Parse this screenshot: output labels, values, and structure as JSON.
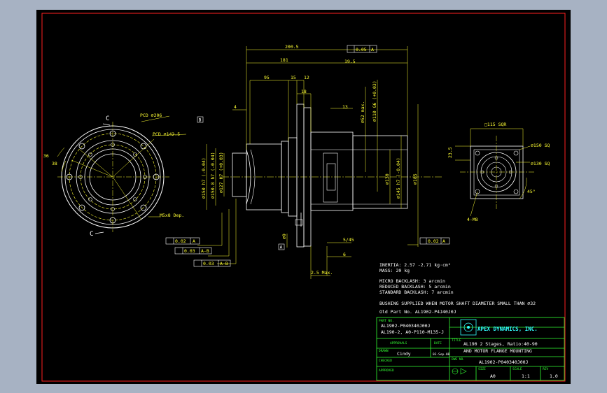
{
  "drawing": {
    "dimensions": {
      "overall_length": "200.5",
      "length_181": "181",
      "length_19_5": "19.5",
      "length_95": "95",
      "length_15": "15",
      "length_12": "12",
      "length_18": "18",
      "length_4": "4",
      "length_13": "13",
      "length_2_5": "2.5 Max.",
      "length_5_45": "5/45",
      "length_6": "6",
      "pcd_206": "PCD ⌀206",
      "pcd_142_5": "PCD ⌀142.5",
      "angle_36": "36",
      "angle_38": "38",
      "hole_spec": "M5x8 Dep.",
      "section_c": "C",
      "datum_b": "B",
      "datum_a": "A",
      "dia_150_h7": "⌀150 h7 (-0.04)",
      "dia_150": "⌀150.8 h7 (-0.04)",
      "dia_127": "⌀127 H7 (+0.03)",
      "dia_9": "⌀9",
      "dia_52": "⌀52 max.",
      "dia_110_g6": "⌀110 G6 (+0.03)",
      "dia_130": "⌀130",
      "dia_145": "⌀145 h7 (-0.04)",
      "dia_185": "⌀185",
      "tol_1": "0.02",
      "tol_2": "0.03",
      "tol_3": "0.03",
      "ref_1": "A",
      "ref_2": "A-B",
      "ref_3": "A-B",
      "tol_right": "0.02",
      "ref_right": "A",
      "tol_top": "0.05",
      "ref_top": "A",
      "square_115": "□115 SQR",
      "length_23_5": "23.5",
      "dia_150_right": "⌀150 SQ",
      "dia_130_right": "⌀130 SQ",
      "angle_45": "45°",
      "holes_4": "4-M8"
    },
    "notes": {
      "inertia": "INERTIA:  2.57 -2.71  kg·cm²",
      "mass": "MASS: 20 kg",
      "micro_backlash": "MICRO BACKLASH: 3 arcmin",
      "reduced_backlash": "REDUCED BACKLASH: 5 arcmin",
      "standard_backlash": "STANDARD BACKLASH: 7 arcmin",
      "bushing": "BUSHING SUPPLIED WHEN MOTOR SHAFT DIAMETER SMALL THAN ⌀32",
      "old_part": "Old Part No. AL1902-P4J40J0J"
    },
    "title_block": {
      "part_no_label": "PART NO.",
      "part_no_1": "AL1902-P040340J00J",
      "part_no_2": "AL190-2, A0-P110-M135-J",
      "company": "APEX DYNAMICS, INC.",
      "title_label": "TITLE",
      "title_1": "AL190 2 Stages, Ratio:40-90",
      "title_2": "AND MOTOR FLANGE MOUNTING",
      "approvals_label": "APPROVALS",
      "date_label": "DATE",
      "drawn_label": "DRAWN",
      "drawn_by": "Cindy",
      "drawn_date": "03-Sep-08",
      "dwg_no_label": "DWG NO.",
      "dwg_no": "AL1902-P040340J00J",
      "checked_label": "CHECKED",
      "approved_label": "APPROVED",
      "size_label": "SIZE",
      "size": "A0",
      "scale_label": "SCALE",
      "scale": "1:1",
      "rev_label": "REV",
      "rev": "1.0"
    }
  },
  "colors": {
    "background": "#000000",
    "viewport_border": "#a7b2c3",
    "frame": "#ff2020",
    "outline": "#ffffff",
    "dimension": "#ffff33",
    "title_block": "#33ff33",
    "cyan": "#33ffff"
  }
}
